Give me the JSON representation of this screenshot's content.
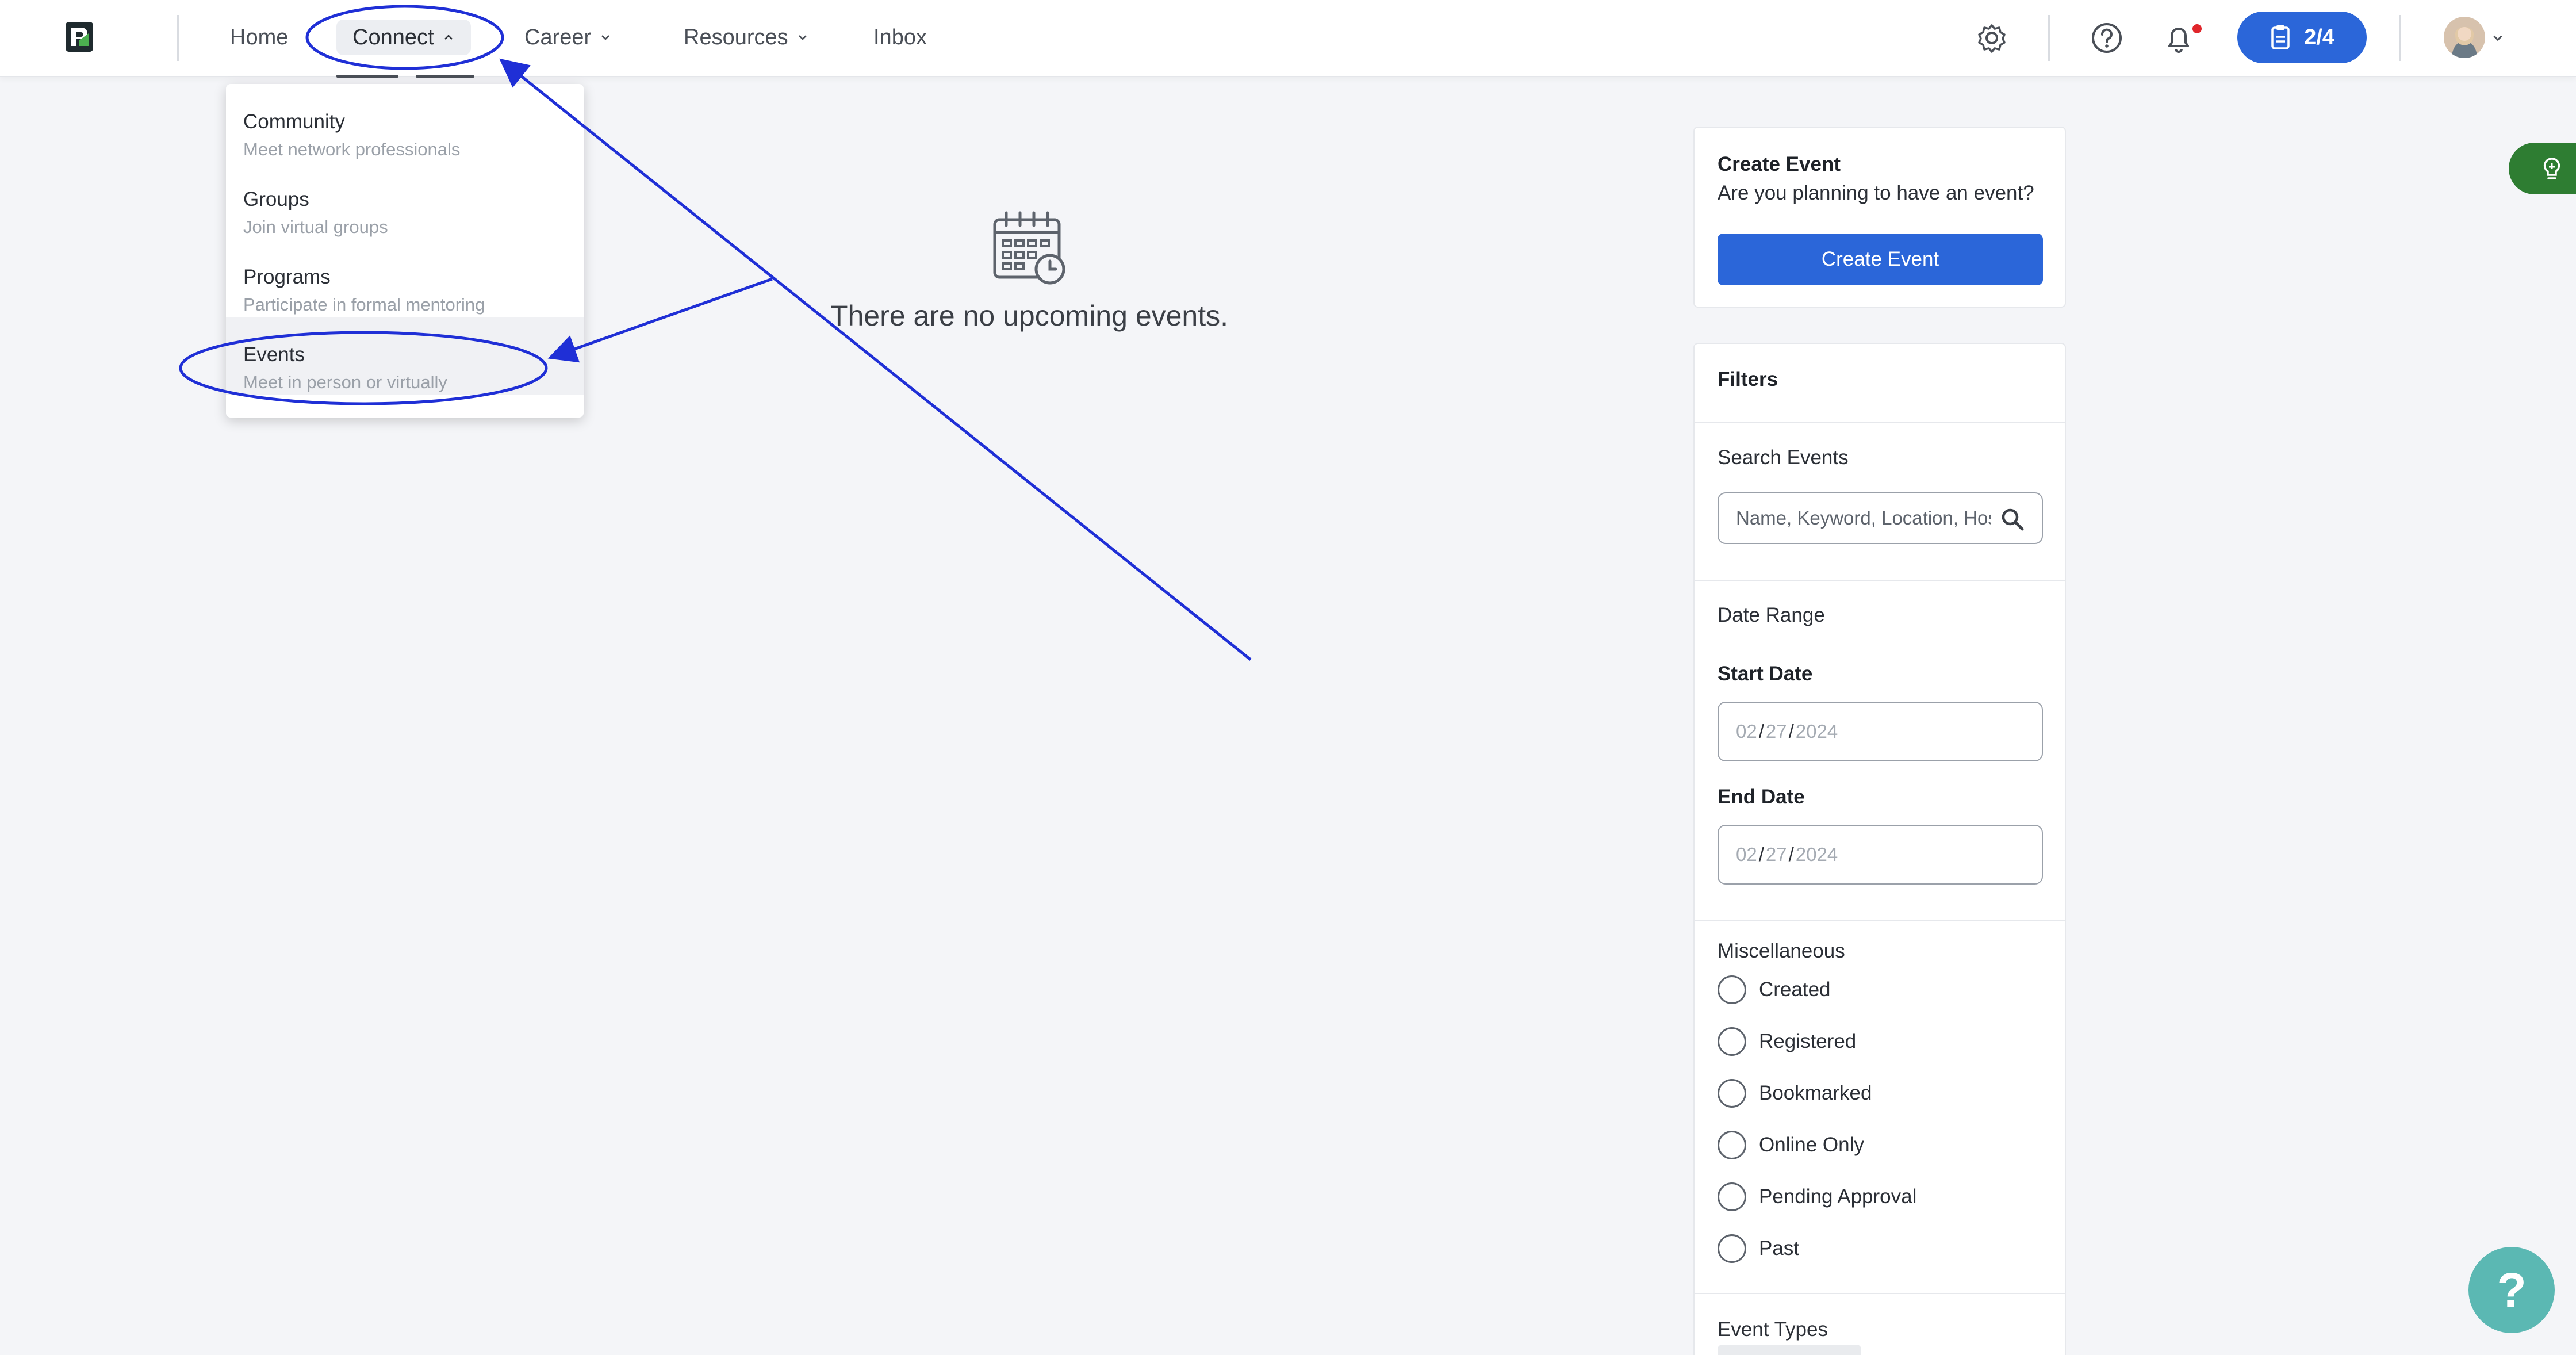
{
  "header": {
    "nav": [
      {
        "label": "Home"
      },
      {
        "label": "Connect"
      },
      {
        "label": "Career"
      },
      {
        "label": "Resources"
      },
      {
        "label": "Inbox"
      }
    ],
    "progress_label": "2/4",
    "colors": {
      "brand_blue": "#2b66d9",
      "notification_dot": "#e0262b"
    }
  },
  "dropdown": {
    "items": [
      {
        "title": "Community",
        "subtitle": "Meet network professionals"
      },
      {
        "title": "Groups",
        "subtitle": "Join virtual groups"
      },
      {
        "title": "Programs",
        "subtitle": "Participate in formal mentoring"
      },
      {
        "title": "Events",
        "subtitle": "Meet in person or virtually"
      }
    ]
  },
  "main": {
    "empty_message": "There are no upcoming events."
  },
  "create_event": {
    "title": "Create Event",
    "subtitle": "Are you planning to have an event?",
    "button_label": "Create Event"
  },
  "filters": {
    "title": "Filters",
    "search_label": "Search Events",
    "search_placeholder": "Name, Keyword, Location, Host",
    "date_range_label": "Date Range",
    "start_date_label": "Start Date",
    "start_date": {
      "month": "02",
      "day": "27",
      "year": "2024"
    },
    "end_date_label": "End Date",
    "end_date": {
      "month": "02",
      "day": "27",
      "year": "2024"
    },
    "misc_label": "Miscellaneous",
    "misc_options": [
      {
        "label": "Created",
        "checked": false
      },
      {
        "label": "Registered",
        "checked": false
      },
      {
        "label": "Bookmarked",
        "checked": false
      },
      {
        "label": "Online Only",
        "checked": false
      },
      {
        "label": "Pending Approval",
        "checked": false
      },
      {
        "label": "Past",
        "checked": false
      }
    ],
    "event_types_label": "Event Types"
  },
  "widgets": {
    "help_label": "?",
    "side_tab_color": "#2e7d32",
    "help_color": "#5bb8b3"
  },
  "icons": [
    "logo-icon",
    "chevron-up-icon",
    "chevron-down-icon",
    "gear-icon",
    "help-circle-icon",
    "bell-icon",
    "clipboard-icon",
    "calendar-icon",
    "search-icon",
    "lightbulb-icon"
  ]
}
